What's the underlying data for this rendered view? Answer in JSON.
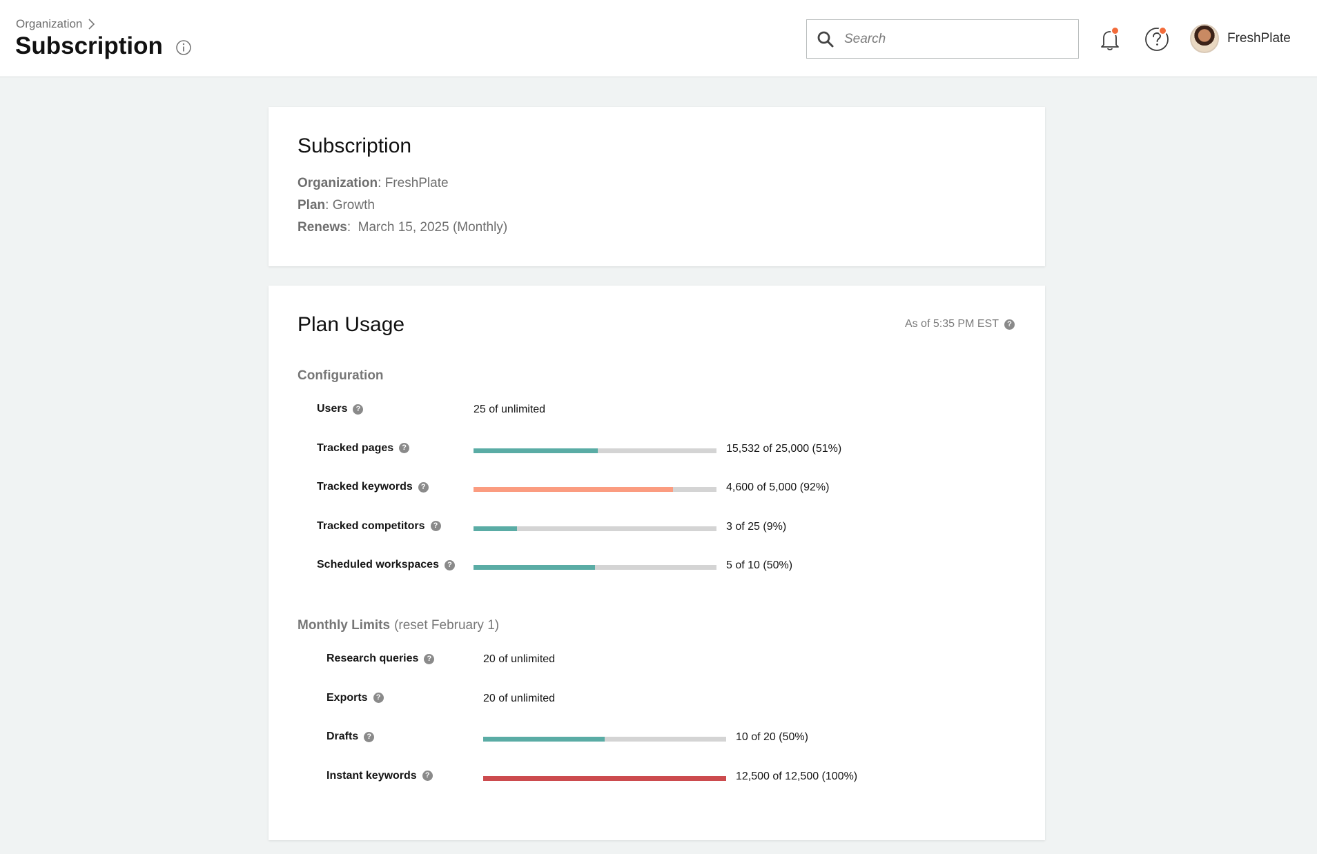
{
  "header": {
    "breadcrumb": "Organization",
    "title": "Subscription",
    "search_placeholder": "Search",
    "user_name": "FreshPlate",
    "notification_dot_color": "#f26b3a"
  },
  "subscription": {
    "title": "Subscription",
    "organization_label": "Organization",
    "organization_value": "FreshPlate",
    "plan_label": "Plan",
    "plan_value": "Growth",
    "renews_label": "Renews",
    "renews_value": "March 15, 2025 (Monthly)"
  },
  "usage": {
    "title": "Plan Usage",
    "as_of": "As of 5:35 PM EST",
    "configuration": {
      "label": "Configuration",
      "items": [
        {
          "label": "Users",
          "text": "25 of unlimited",
          "has_bar": false
        },
        {
          "label": "Tracked pages",
          "text": "15,532 of 25,000 (51%)",
          "has_bar": true,
          "fraction": 0.51,
          "color": "#5aaca5"
        },
        {
          "label": "Tracked keywords",
          "text": "4,600 of 5,000 (92%)",
          "has_bar": true,
          "fraction": 0.82,
          "color": "#fb9c80"
        },
        {
          "label": "Tracked competitors",
          "text": "3 of 25 (9%)",
          "has_bar": true,
          "fraction": 0.18,
          "color": "#5aaca5"
        },
        {
          "label": "Scheduled workspaces",
          "text": "5 of 10 (50%)",
          "has_bar": true,
          "fraction": 0.5,
          "color": "#5aaca5"
        }
      ]
    },
    "monthly": {
      "label": "Monthly Limits",
      "note": "(reset February 1)",
      "items": [
        {
          "label": "Research queries",
          "text": "20 of unlimited",
          "has_bar": false
        },
        {
          "label": "Exports",
          "text": "20 of unlimited",
          "has_bar": false
        },
        {
          "label": "Drafts",
          "text": "10 of 20 (50%)",
          "has_bar": true,
          "fraction": 0.5,
          "color": "#5aaca5"
        },
        {
          "label": "Instant keywords",
          "text": "12,500 of 12,500 (100%)",
          "has_bar": true,
          "fraction": 1.0,
          "color": "#cc4b4e"
        }
      ]
    }
  }
}
